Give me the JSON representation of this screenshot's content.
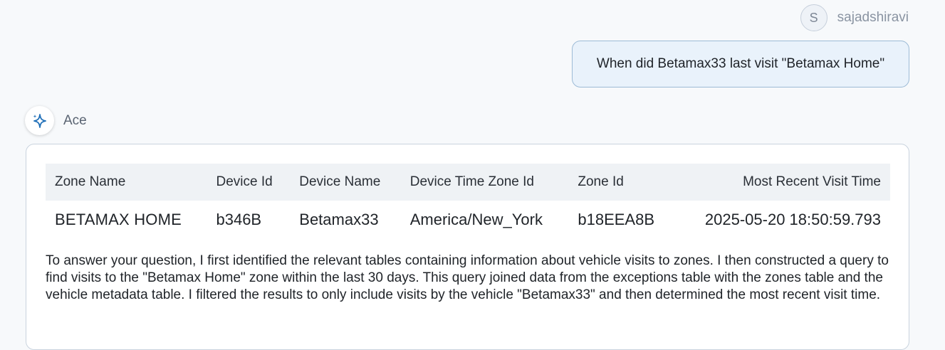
{
  "user": {
    "avatar_initial": "S",
    "name": "sajadshiravi",
    "message": "When did Betamax33 last visit \"Betamax Home\""
  },
  "assistant": {
    "name": "Ace",
    "icon": "sparkle-icon",
    "table": {
      "columns": [
        "Zone Name",
        "Device Id",
        "Device Name",
        "Device Time Zone Id",
        "Zone Id",
        "Most Recent Visit Time"
      ],
      "rows": [
        [
          "BETAMAX HOME",
          "b346B",
          "Betamax33",
          "America/New_York",
          "b18EEA8B",
          "2025-05-20 18:50:59.793"
        ]
      ]
    },
    "explanation": "To answer your question, I first identified the relevant tables containing information about vehicle visits to zones.  I then constructed a query to find visits to the \"Betamax Home\" zone within the last 30 days. This query joined data from the exceptions table with the zones table and the vehicle metadata table. I filtered the results to only include visits by the vehicle \"Betamax33\" and then determined the most recent visit time."
  },
  "colors": {
    "accent": "#1f6fb8",
    "bubble_bg": "#e9f2fb",
    "bubble_border": "#9dbbd6"
  }
}
